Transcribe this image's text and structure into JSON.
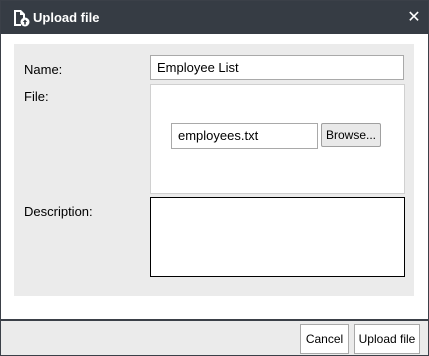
{
  "dialog": {
    "title": "Upload file",
    "close_icon": "close-icon",
    "title_icon": "file-upload-icon"
  },
  "form": {
    "name_label": "Name:",
    "name_value": "Employee List",
    "file_label": "File:",
    "file_value": "employees.txt",
    "browse_label": "Browse...",
    "description_label": "Description:",
    "description_value": ""
  },
  "footer": {
    "cancel_label": "Cancel",
    "upload_label": "Upload file"
  },
  "colors": {
    "titlebar": "#363c44",
    "panel": "#ebebeb",
    "border": "#3b4048"
  }
}
